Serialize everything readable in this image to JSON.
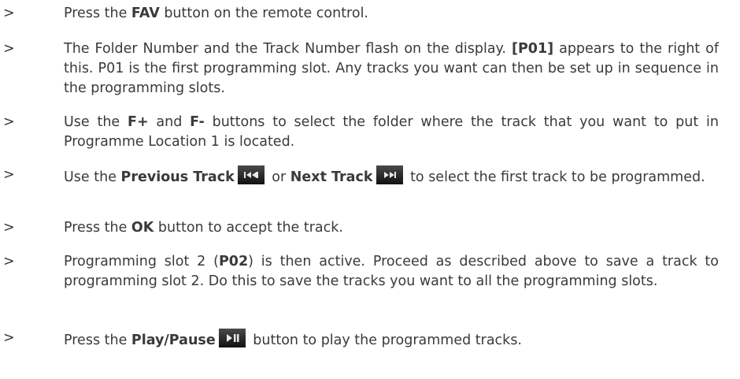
{
  "marker": ">",
  "steps": [
    {
      "p1": "Press the ",
      "b1": "FAV",
      "p2": " button on the remote control."
    },
    {
      "p1": "The Folder Number and the Track Number flash on the display. ",
      "b1": "[P01]",
      "p2": " appears to the right of this. P01 is the first programming slot. Any tracks you want can then be set up in sequence in the programming slots."
    },
    {
      "p1": "Use the ",
      "b1": "F+",
      "p2": " and ",
      "b2": "F-",
      "p3": " buttons to select the folder where the track that you want to put in Programme Location 1 is located."
    },
    {
      "p1": "Use the ",
      "b1": "Previous Track",
      "icon1": "previous-track-icon",
      "p2": " or ",
      "b2": "Next Track",
      "icon2": "next-track-icon",
      "p3": " to select the first track to be programmed."
    },
    {
      "p1": "Press the ",
      "b1": "OK",
      "p2": " button to accept the track."
    },
    {
      "p1": "Programming slot 2 (",
      "b1": "P02",
      "p2": ") is then active. Proceed as described above to save a track to programming slot 2. Do this to save the tracks you want to all the programming slots."
    },
    {
      "p1": "Press the ",
      "b1": "Play/Pause",
      "icon1": "play-pause-icon",
      "p2": " button to play the programmed tracks."
    }
  ],
  "colors": {
    "text": "#3a3a3a",
    "icon_bg": "#222222",
    "icon_glyph": "#e8e8e8"
  }
}
